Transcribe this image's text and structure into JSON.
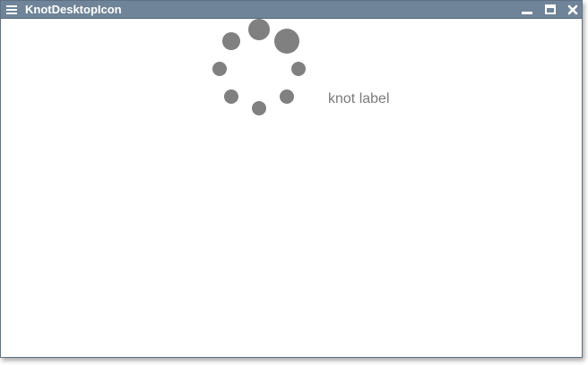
{
  "window": {
    "title": "KnotDesktopIcon"
  },
  "icons": {
    "menu": "hamburger-menu-icon",
    "minimize": "minimize-icon",
    "maximize": "maximize-icon",
    "close": "close-icon",
    "spinner": "loading-spinner-icon"
  },
  "knot": {
    "label": "knot label"
  },
  "colors": {
    "titlebar": "#6f8498",
    "spinner_dot": "#808080",
    "label_text": "#7a7a7a"
  }
}
